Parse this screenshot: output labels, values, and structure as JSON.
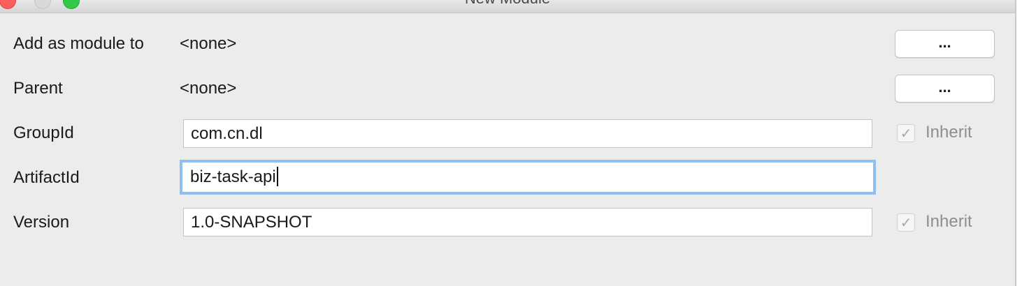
{
  "window": {
    "title": "New Module"
  },
  "form": {
    "add_as_module_to": {
      "label": "Add as module to",
      "value": "<none>",
      "button_label": "..."
    },
    "parent": {
      "label": "Parent",
      "value": "<none>",
      "button_label": "..."
    },
    "group_id": {
      "label": "GroupId",
      "value": "com.cn.dl",
      "inherit_label": "Inherit",
      "inherit_checked": true
    },
    "artifact_id": {
      "label": "ArtifactId",
      "value": "biz-task-api",
      "focused": true
    },
    "version": {
      "label": "Version",
      "value": "1.0-SNAPSHOT",
      "inherit_label": "Inherit",
      "inherit_checked": true
    }
  },
  "icons": {
    "checkmark": "✓"
  },
  "colors": {
    "focus_ring": "#8ec0ef",
    "close": "#fc605c",
    "zoom": "#34c84a",
    "disabled_text": "#8e8e8e"
  }
}
